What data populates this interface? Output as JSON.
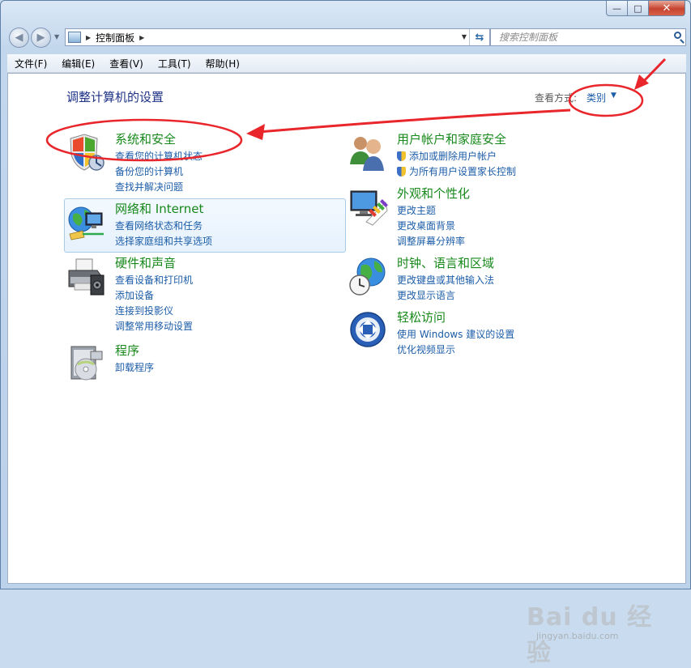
{
  "window": {
    "buttons": {
      "minimize": "—",
      "maximize": "□",
      "close": "✕"
    }
  },
  "nav": {
    "back_glyph": "◀",
    "forward_glyph": "▶",
    "breadcrumb": "控制面板",
    "search_placeholder": "搜索控制面板"
  },
  "menu": [
    "文件(F)",
    "编辑(E)",
    "查看(V)",
    "工具(T)",
    "帮助(H)"
  ],
  "content": {
    "title": "调整计算机的设置",
    "view_by_label": "查看方式:",
    "view_by_value": "类别",
    "categories": [
      {
        "id": "system-security",
        "title": "系统和安全",
        "icon": "shield-icon",
        "links": [
          "查看您的计算机状态",
          "备份您的计算机",
          "查找并解决问题"
        ]
      },
      {
        "id": "network-internet",
        "title": "网络和 Internet",
        "icon": "globe-network-icon",
        "links": [
          "查看网络状态和任务",
          "选择家庭组和共享选项"
        ]
      },
      {
        "id": "hardware-sound",
        "title": "硬件和声音",
        "icon": "printer-icon",
        "links": [
          "查看设备和打印机",
          "添加设备",
          "连接到投影仪",
          "调整常用移动设置"
        ]
      },
      {
        "id": "programs",
        "title": "程序",
        "icon": "programs-icon",
        "links": [
          "卸载程序"
        ]
      },
      {
        "id": "user-accounts",
        "title": "用户帐户和家庭安全",
        "icon": "users-icon",
        "links": [
          "添加或删除用户帐户",
          "为所有用户设置家长控制"
        ]
      },
      {
        "id": "appearance",
        "title": "外观和个性化",
        "icon": "monitor-palette-icon",
        "links": [
          "更改主题",
          "更改桌面背景",
          "调整屏幕分辨率"
        ]
      },
      {
        "id": "clock-region",
        "title": "时钟、语言和区域",
        "icon": "clock-globe-icon",
        "links": [
          "更改键盘或其他输入法",
          "更改显示语言"
        ]
      },
      {
        "id": "ease-access",
        "title": "轻松访问",
        "icon": "ease-of-access-icon",
        "links": [
          "使用 Windows 建议的设置",
          "优化视频显示"
        ]
      }
    ]
  },
  "annotation": {
    "color": "#e8262b"
  },
  "watermark": {
    "logo": "Bai du 经验",
    "url": "jingyan.baidu.com"
  }
}
